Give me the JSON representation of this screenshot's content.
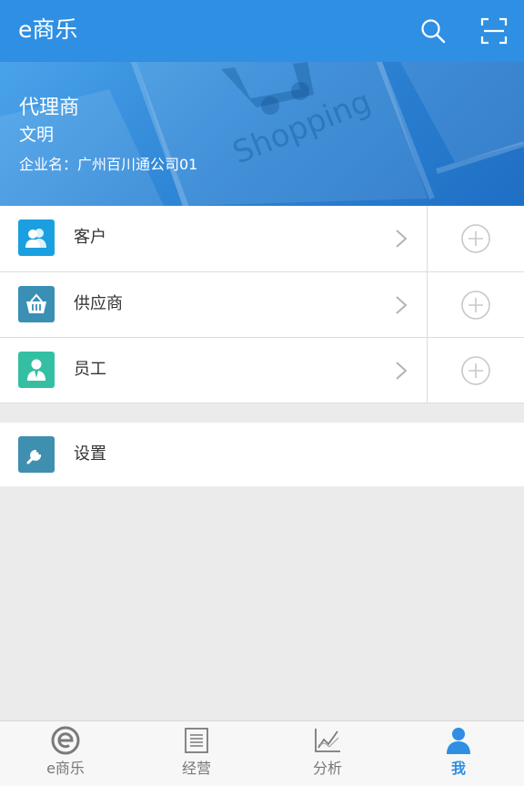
{
  "app_bar": {
    "title": "e商乐",
    "icons": [
      "search-icon",
      "scan-icon"
    ]
  },
  "banner": {
    "role": "代理商",
    "name": "文明",
    "company": "企业名：广州百川通公司01",
    "background_text": "Shopping"
  },
  "menu": {
    "items": [
      {
        "label": "客户",
        "icon": "contacts-icon",
        "color": "#1a9fe0"
      },
      {
        "label": "供应商",
        "icon": "basket-icon",
        "color": "#3a8fb4"
      },
      {
        "label": "员工",
        "icon": "employee-icon",
        "color": "#34bfa3"
      }
    ]
  },
  "settings": {
    "label": "设置",
    "icon": "wrench-icon",
    "color": "#3f8fb0"
  },
  "tabs": [
    {
      "label": "e商乐",
      "icon": "e-logo-icon",
      "active": false
    },
    {
      "label": "经营",
      "icon": "list-icon",
      "active": false
    },
    {
      "label": "分析",
      "icon": "chart-icon",
      "active": false
    },
    {
      "label": "我",
      "icon": "person-icon",
      "active": true
    }
  ],
  "colors": {
    "primary": "#2e8fe3",
    "background": "#ebebeb"
  }
}
